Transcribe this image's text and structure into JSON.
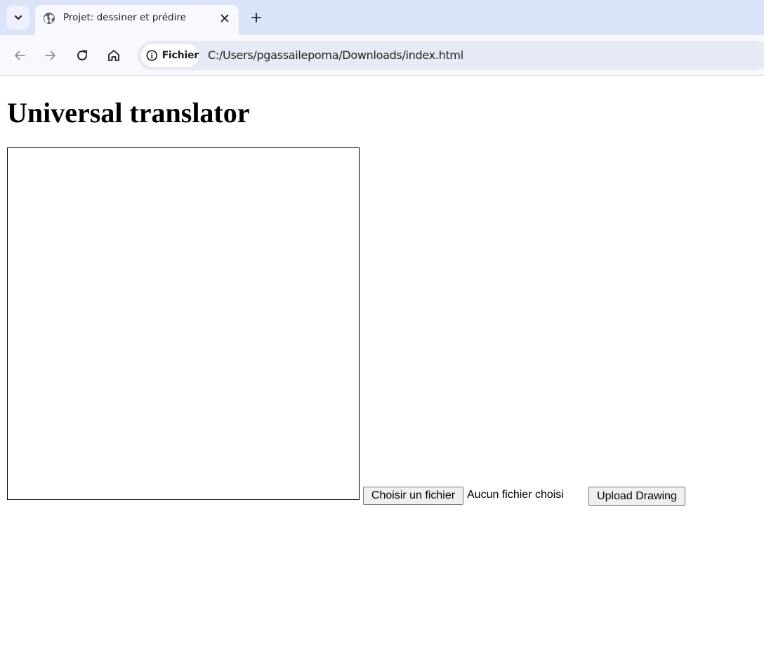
{
  "browser": {
    "tab": {
      "title": "Projet: dessiner et prédire",
      "favicon": "globe-icon"
    },
    "site_chip_label": "Fichier",
    "url": "C:/Users/pgassailepoma/Downloads/index.html",
    "icons": {
      "tab_search": "chevron-down-icon",
      "close": "close-icon",
      "new_tab": "plus-icon",
      "back": "arrow-left-icon",
      "forward": "arrow-right-icon",
      "reload": "reload-icon",
      "home": "home-icon",
      "site_info": "info-icon"
    },
    "colors": {
      "tabstrip": "#dbe3f9",
      "toolbar": "#f8f9fe",
      "omnibox": "#e6eaf4"
    }
  },
  "page": {
    "heading": "Universal translator",
    "file_input": {
      "button_label": "Choisir un fichier",
      "status": "Aucun fichier choisi"
    },
    "upload_button_label": "Upload Drawing"
  }
}
